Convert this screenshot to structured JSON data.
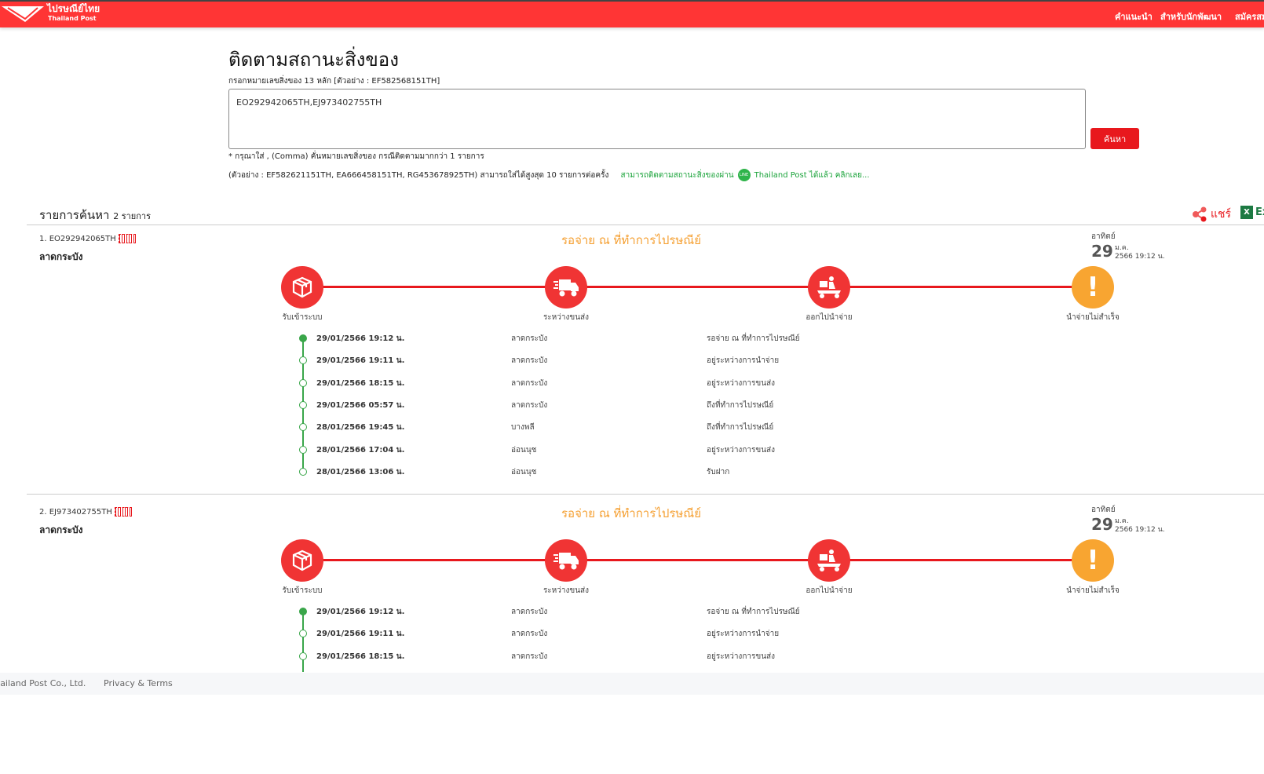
{
  "header": {
    "logo_th": "ไปรษณีย์ไทย",
    "logo_en": "Thailand Post",
    "nav": [
      "คำแนะนำ",
      "สำหรับนักพัฒนา",
      "สมัครสมาชิก"
    ]
  },
  "page": {
    "title": "ติดตามสถานะสิ่งของ",
    "input_label": "กรอกหมายเลขสิ่งของ 13 หลัก [ตัวอย่าง : EF582568151TH]",
    "input_value": "EO292942065TH,EJ973402755TH",
    "search_label": "ค้นหา",
    "note1": "* กรุณาใส่ , (Comma) คั่นหมายเลขสิ่งของ กรณีติดตามมากกว่า 1 รายการ",
    "note2": "(ตัวอย่าง : EF582621151TH, EA666458151TH, RG453678925TH) สามารถใส่ได้สูงสุด 10 รายการต่อครั้ง",
    "line_promo": "สามารถติดตามสถานะสิ่งของผ่าน",
    "line_icon": "LINE",
    "line_link": "Thailand Post ได้แล้ว คลิกเลย..."
  },
  "results": {
    "title": "รายการค้นหา",
    "count": "2 รายการ",
    "share": "แชร์",
    "excel": "Excel"
  },
  "steps": [
    "รับเข้าระบบ",
    "ระหว่างขนส่ง",
    "ออกไปนำจ่าย",
    "นำจ่ายไม่สำเร็จ"
  ],
  "items": [
    {
      "tracking": "1. EO292942065TH",
      "name": "ลาดกระบัง",
      "status": "รอจ่าย ณ ที่ทำการไปรษณีย์",
      "day": "อาทิตย์",
      "date": "29",
      "month": "ม.ค.",
      "year_time": "2566  19:12 น.",
      "events": [
        {
          "date": "29/01/2566 19:12 น.",
          "location": "ลาดกระบัง",
          "status": "รอจ่าย ณ ที่ทำการไปรษณีย์"
        },
        {
          "date": "29/01/2566 19:11 น.",
          "location": "ลาดกระบัง",
          "status": "อยู่ระหว่างการนำจ่าย"
        },
        {
          "date": "29/01/2566 18:15 น.",
          "location": "ลาดกระบัง",
          "status": "อยู่ระหว่างการขนส่ง"
        },
        {
          "date": "29/01/2566 05:57 น.",
          "location": "ลาดกระบัง",
          "status": "ถึงที่ทำการไปรษณีย์"
        },
        {
          "date": "28/01/2566 19:45 น.",
          "location": "บางพลี",
          "status": "ถึงที่ทำการไปรษณีย์"
        },
        {
          "date": "28/01/2566 17:04 น.",
          "location": "อ่อนนุช",
          "status": "อยู่ระหว่างการขนส่ง"
        },
        {
          "date": "28/01/2566 13:06 น.",
          "location": "อ่อนนุช",
          "status": "รับฝาก"
        }
      ]
    },
    {
      "tracking": "2. EJ973402755TH",
      "name": "ลาดกระบัง",
      "status": "รอจ่าย ณ ที่ทำการไปรษณีย์",
      "day": "อาทิตย์",
      "date": "29",
      "month": "ม.ค.",
      "year_time": "2566  19:12 น.",
      "events": [
        {
          "date": "29/01/2566 19:12 น.",
          "location": "ลาดกระบัง",
          "status": "รอจ่าย ณ ที่ทำการไปรษณีย์"
        },
        {
          "date": "29/01/2566 19:11 น.",
          "location": "ลาดกระบัง",
          "status": "อยู่ระหว่างการนำจ่าย"
        },
        {
          "date": "29/01/2566 18:15 น.",
          "location": "ลาดกระบัง",
          "status": "อยู่ระหว่างการขนส่ง"
        }
      ]
    }
  ],
  "footer": {
    "company": "© Thailand Post Co., Ltd.",
    "privacy": "Privacy & Terms"
  }
}
